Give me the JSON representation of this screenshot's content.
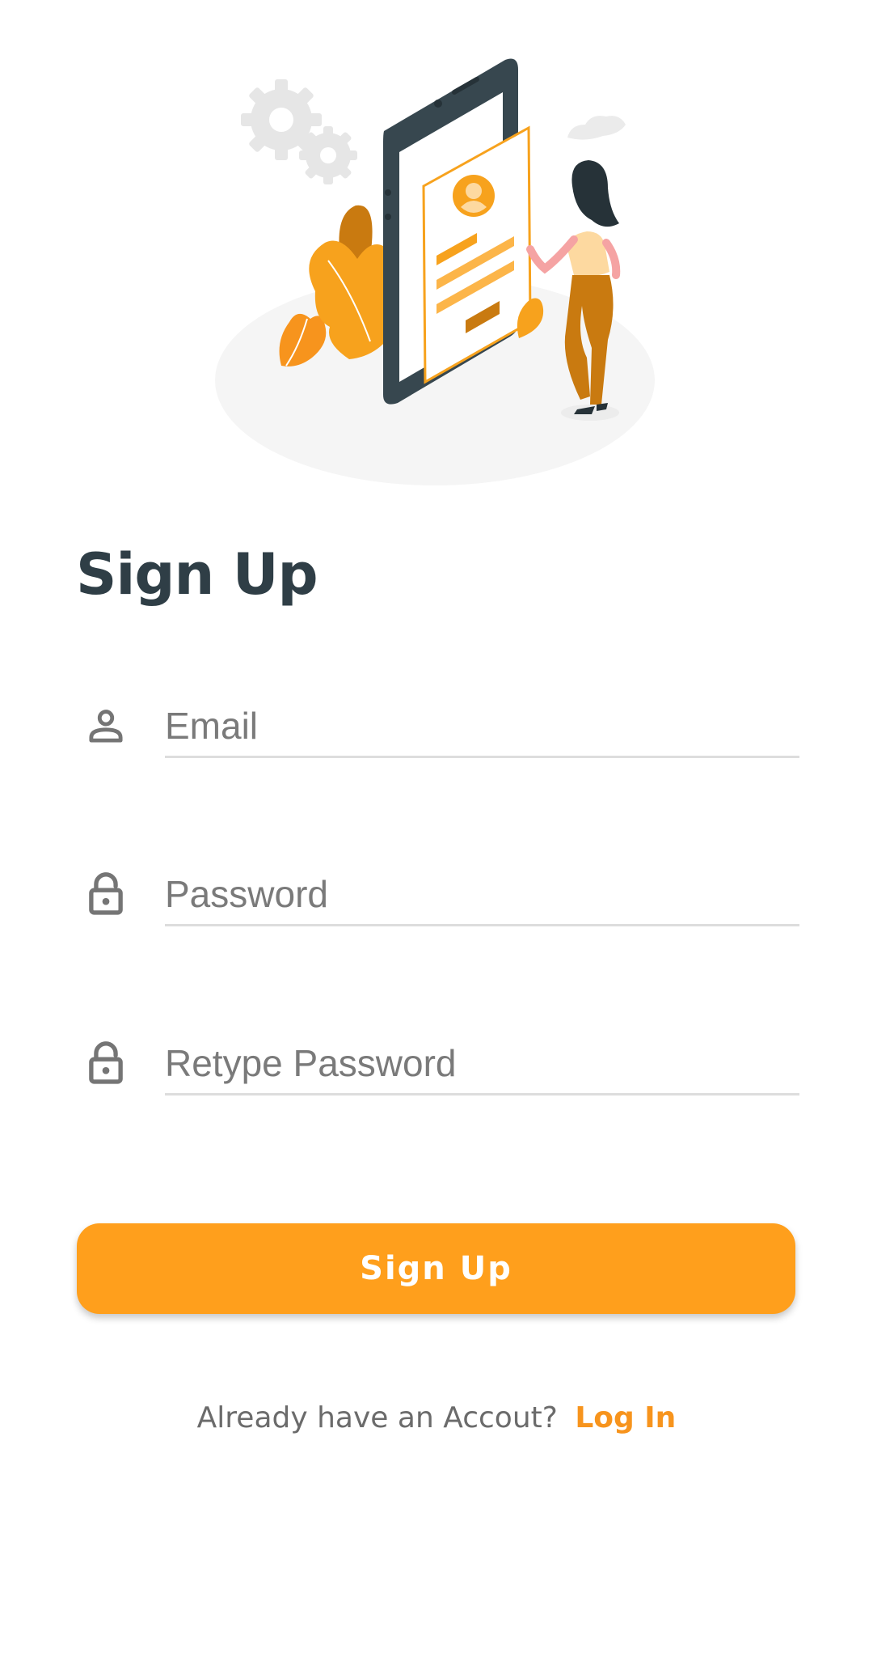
{
  "header": {
    "title": "Sign Up"
  },
  "form": {
    "email": {
      "placeholder": "Email",
      "value": "",
      "icon": "person-icon"
    },
    "password": {
      "placeholder": "Password",
      "value": "",
      "icon": "lock-icon"
    },
    "retype_password": {
      "placeholder": "Retype Password",
      "value": "",
      "icon": "lock-icon"
    },
    "submit_label": "Sign Up"
  },
  "footer": {
    "prompt": "Already have an Accout?",
    "link_label": "Log In"
  },
  "theme": {
    "accent": "#ff9f1c",
    "link": "#f7941d",
    "title": "#2f3e46",
    "icon": "#757575",
    "underline": "#dddddd"
  },
  "illustration": {
    "name": "signup-illustration"
  }
}
